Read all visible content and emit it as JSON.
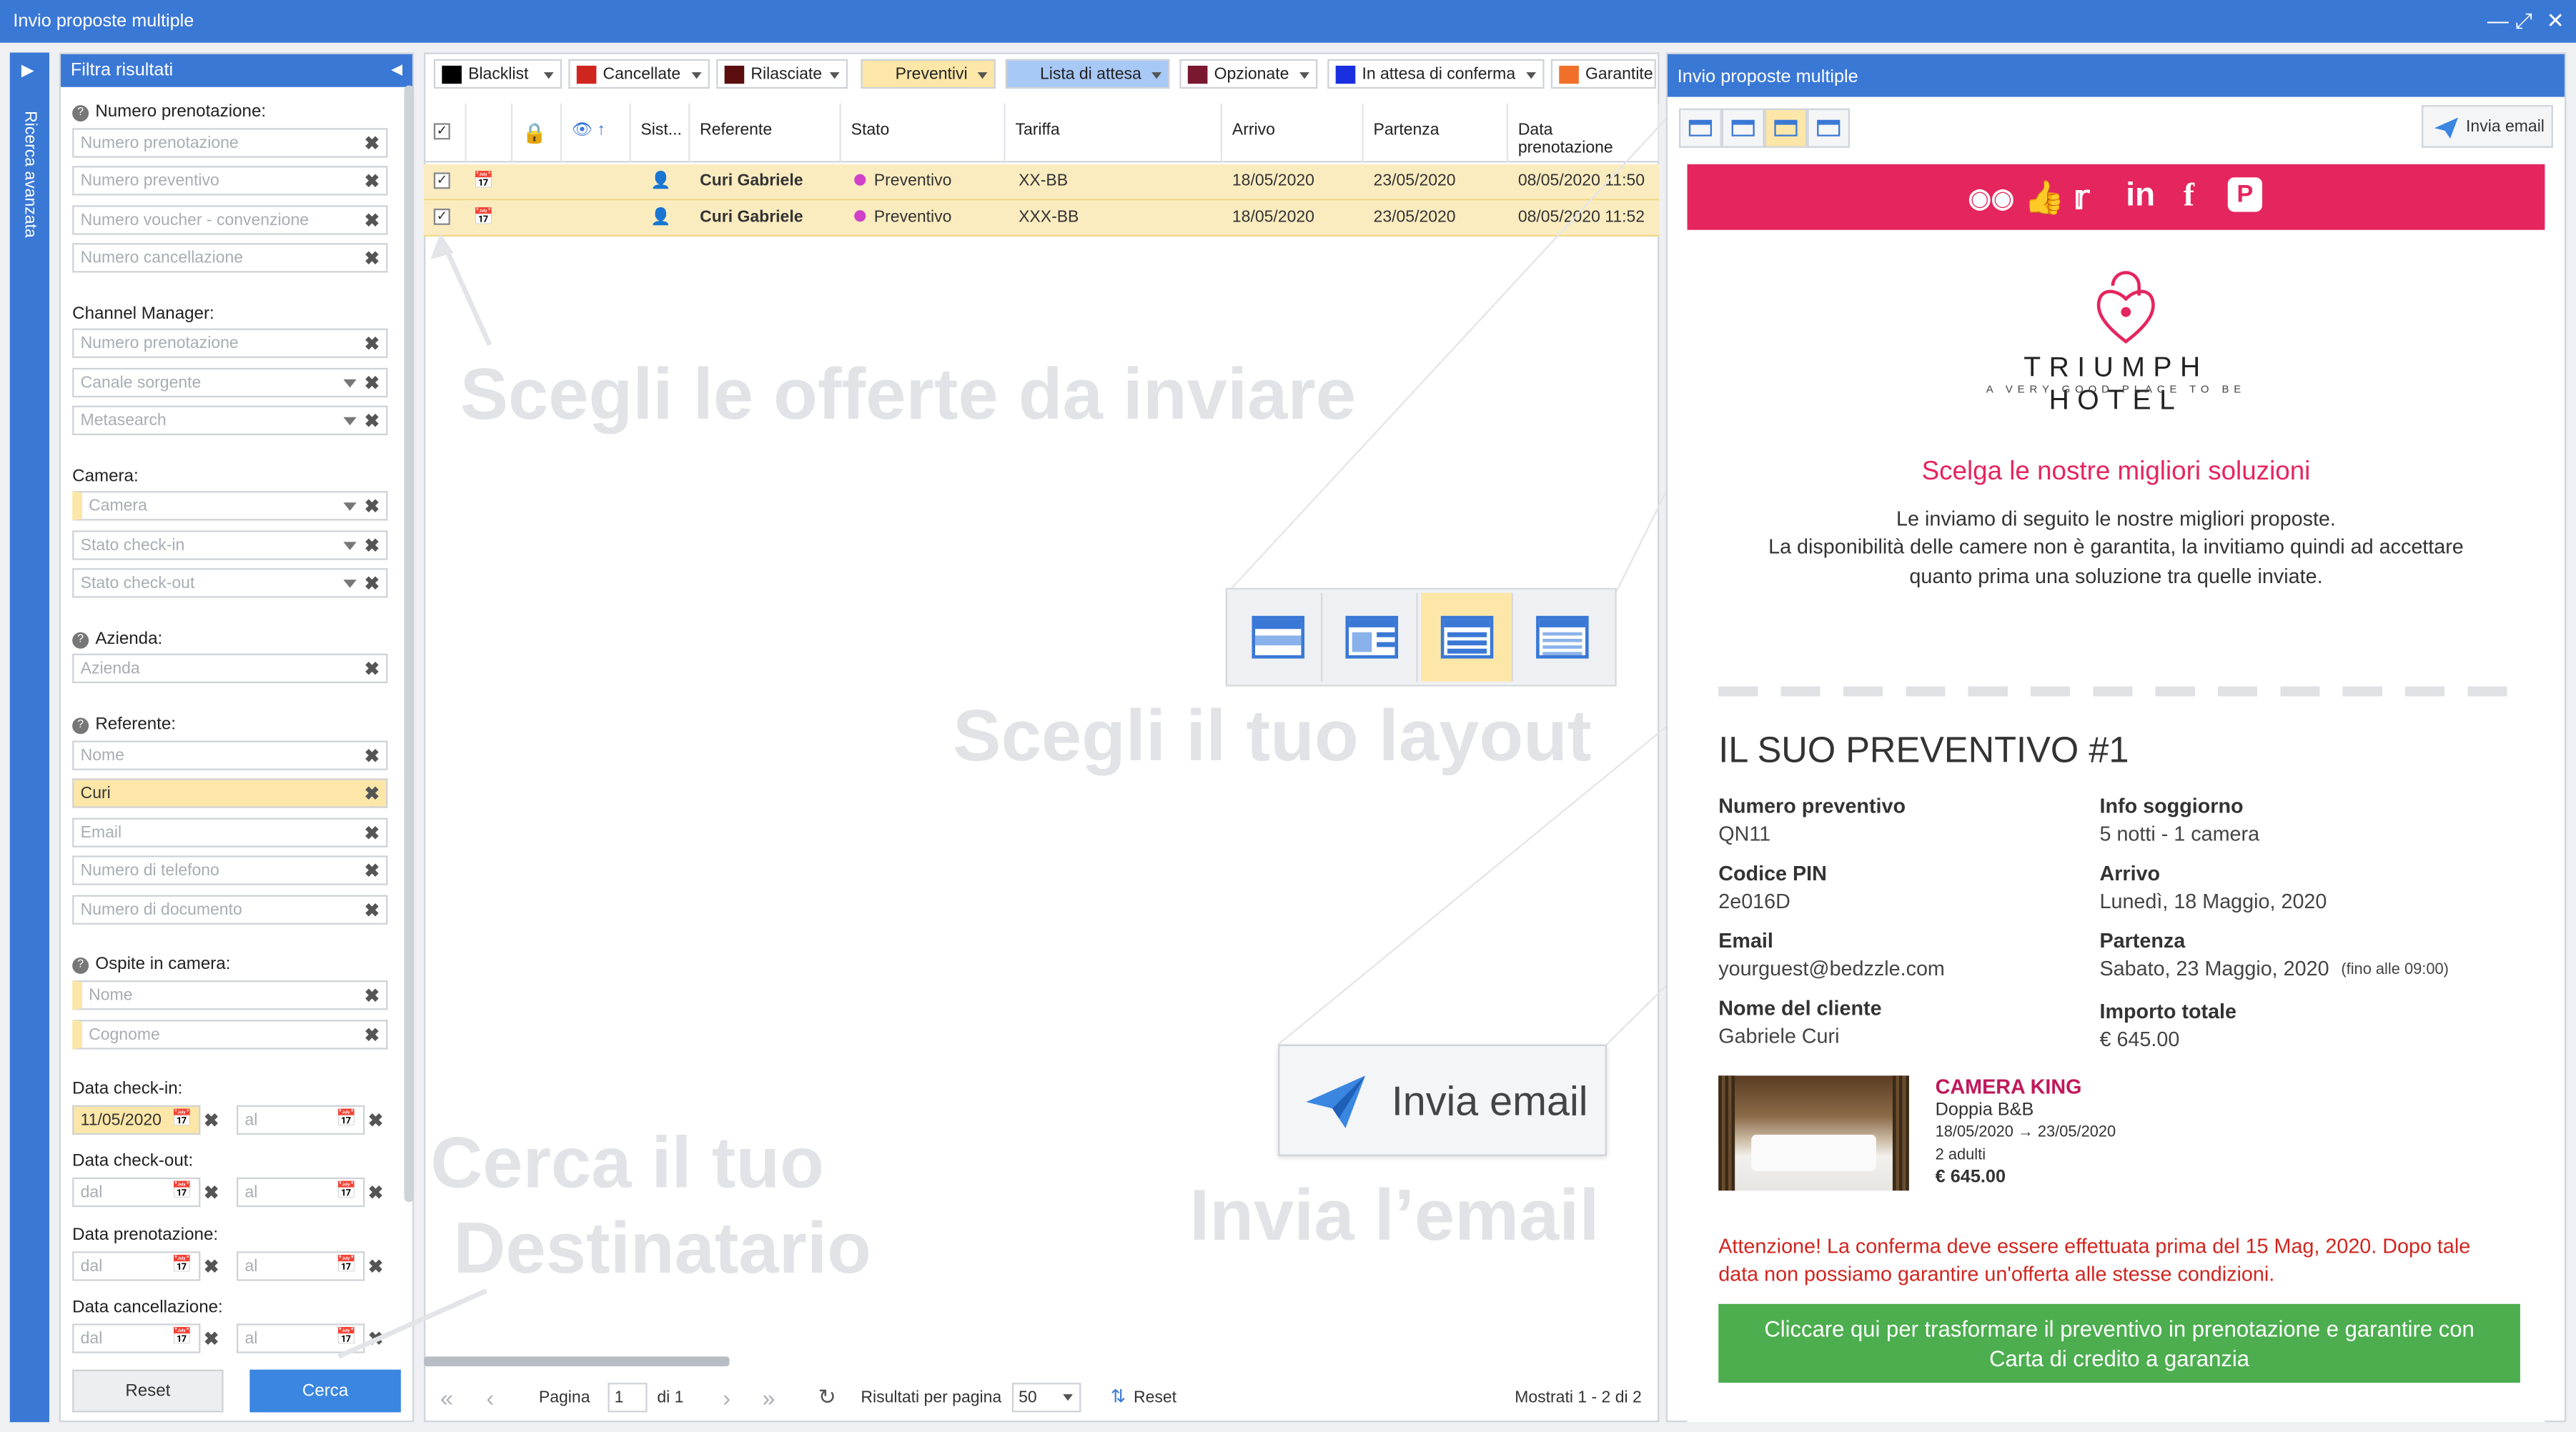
{
  "window": {
    "title": "Invio proposte multiple"
  },
  "sidebar": {
    "vertical_label": "Ricerca avanzata"
  },
  "filter": {
    "title": "Filtra risultati",
    "groups": {
      "numero_prenotazione": "Numero prenotazione:",
      "channel_manager": "Channel Manager:",
      "camera": "Camera:",
      "azienda": "Azienda:",
      "referente": "Referente:",
      "ospite": "Ospite in camera:",
      "checkin": "Data check-in:",
      "checkout": "Data check-out:",
      "prenotazione": "Data prenotazione:",
      "cancellazione": "Data cancellazione:"
    },
    "fields": {
      "num_pren": "Numero prenotazione",
      "num_prev": "Numero preventivo",
      "num_voucher": "Numero voucher - convenzione",
      "num_canc": "Numero cancellazione",
      "cm_num": "Numero prenotazione",
      "cm_canale": "Canale sorgente",
      "cm_meta": "Metasearch",
      "camera": "Camera",
      "stato_in": "Stato check-in",
      "stato_out": "Stato check-out",
      "azienda": "Azienda",
      "ref_nome": "Nome",
      "ref_cognome": "Curi",
      "ref_email": "Email",
      "ref_tel": "Numero di telefono",
      "ref_doc": "Numero di documento",
      "osp_nome": "Nome",
      "osp_cognome": "Cognome",
      "dal": "dal",
      "al": "al",
      "checkin_dal": "11/05/2020"
    },
    "reset": "Reset",
    "search": "Cerca"
  },
  "toolbar": {
    "filters": [
      {
        "label": "Blacklist",
        "color": "#000000"
      },
      {
        "label": "Cancellate",
        "color": "#d0251f"
      },
      {
        "label": "Rilasciate",
        "color": "#5a0e0e"
      },
      {
        "label": "Preventivi",
        "color": "#fce7a8"
      },
      {
        "label": "Lista di attesa",
        "color": "#a8c8f5"
      },
      {
        "label": "Opzionate",
        "color": "#7a1830"
      },
      {
        "label": "In attesa di conferma",
        "color": "#1a2fe0"
      },
      {
        "label": "Garantite",
        "color": "#f0702a"
      }
    ]
  },
  "table": {
    "headers": [
      "Sist...",
      "Referente",
      "Stato",
      "Tariffa",
      "Arrivo",
      "Partenza",
      "Data prenotazione"
    ],
    "rows": [
      {
        "referente": "Curi Gabriele",
        "stato": "Preventivo",
        "tariffa": "XX-BB",
        "arrivo": "18/05/2020",
        "partenza": "23/05/2020",
        "data": "08/05/2020 11:50"
      },
      {
        "referente": "Curi Gabriele",
        "stato": "Preventivo",
        "tariffa": "XXX-BB",
        "arrivo": "18/05/2020",
        "partenza": "23/05/2020",
        "data": "08/05/2020 11:52"
      }
    ]
  },
  "overlays": {
    "scegli_offerte": "Scegli le offerte da inviare",
    "scegli_layout": "Scegli il tuo layout",
    "cerca_1": "Cerca il tuo",
    "cerca_2": "Destinatario",
    "invia": "Invia l’email",
    "invia_btn": "Invia email"
  },
  "pager": {
    "page_label": "Pagina",
    "page": "1",
    "of": "di 1",
    "per_page_label": "Risultati per pagina",
    "per_page": "50",
    "reset": "Reset",
    "shown": "Mostrati 1 - 2 di 2"
  },
  "preview": {
    "title": "Invio proposte multiple",
    "send": "Invia email",
    "hotel_name": "TRIUMPH HOTEL",
    "hotel_tagline": "A VERY GOOD PLACE TO BE",
    "headline": "Scelga le nostre migliori soluzioni",
    "intro1": "Le inviamo di seguito le nostre migliori proposte.",
    "intro2": "La disponibilità delle camere non è garantita, la invitiamo quindi ad accettare",
    "intro3": "quanto prima una soluzione tra quelle inviate.",
    "quote_title": "IL SUO PREVENTIVO #1",
    "left": [
      {
        "k": "Numero preventivo",
        "v": "QN11"
      },
      {
        "k": "Codice PIN",
        "v": "2e016D"
      },
      {
        "k": "Email",
        "v": "yourguest@bedzzle.com"
      },
      {
        "k": "Nome del cliente",
        "v": "Gabriele Curi"
      }
    ],
    "right": [
      {
        "k": "Info soggiorno",
        "v": "5 notti - 1 camera"
      },
      {
        "k": "Arrivo",
        "v": "Lunedì, 18 Maggio, 2020"
      },
      {
        "k": "Partenza",
        "v": "Sabato, 23 Maggio, 2020"
      },
      {
        "k": "Importo totale",
        "v": "€ 645.00"
      }
    ],
    "partenza_note": "(fino alle 09:00)",
    "room": {
      "name": "CAMERA KING",
      "type": "Doppia B&B",
      "dates": "18/05/2020 → 23/05/2020",
      "guests": "2 adulti",
      "price": "€ 645.00"
    },
    "warning1": "Attenzione! La conferma deve essere effettuata prima del 15 Mag, 2020. Dopo tale",
    "warning2": "data non possiamo garantire un'offerta alle stesse condizioni.",
    "cta1": "Cliccare qui per trasformare il preventivo in prenotazione e garantire con",
    "cta2": "Carta di credito a garanzia",
    "accent": "#e5255e"
  }
}
